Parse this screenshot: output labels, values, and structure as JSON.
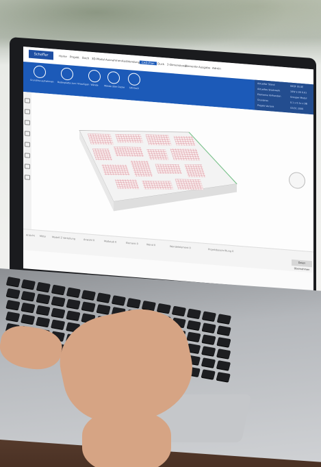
{
  "app": {
    "logo_text": "Scheffer",
    "menu": [
      "Home",
      "Projekt",
      "Dach",
      "3D-Modul",
      "Ausnahmen",
      "Ausblendung",
      "CAD-Plan",
      "Duck",
      "2-Dimensional",
      "Elemente",
      "Ausgabe",
      "Admin"
    ],
    "ribbon_buttons": [
      {
        "label": "Grundriss aufnehmen",
        "icon": "drawing-icon"
      },
      {
        "label": "Bodenplatte zum Hinzufügen",
        "icon": "floor-plate-icon"
      },
      {
        "label": "Wände",
        "icon": "wall-icon"
      },
      {
        "label": "Wände über Decke",
        "icon": "wall-over-ceiling-icon"
      },
      {
        "label": "SW-Dach",
        "icon": "roof-icon"
      }
    ],
    "info_panel": [
      "Aktueller Stand",
      "Aktuelles Stockwerk",
      "Elemente Vorhanden",
      "Grundriss",
      "Projekt Variant"
    ],
    "info_values": [
      "00QF 05.0E",
      "10W 2.00 0.01",
      "Grouper Modul",
      "0.1 x 0.1x x 9B",
      "CE/01 2000"
    ],
    "status_bar": [
      "Ansicht",
      "Mitte",
      "Modell Z Verteilung",
      "Anwahl 0",
      "Maßstab 0",
      "Element 0",
      "Wand 0",
      "Wandelelement 0",
      "Projektbeschriftung 0"
    ],
    "apply_label": "Daten Übernehmen",
    "brand_footer": "mewession"
  },
  "colors": {
    "ribbon_blue": "#1c5ab8",
    "grid_red": "#c9546a",
    "slab_white": "#f4f4f4",
    "edge_green": "#7dc48e"
  }
}
